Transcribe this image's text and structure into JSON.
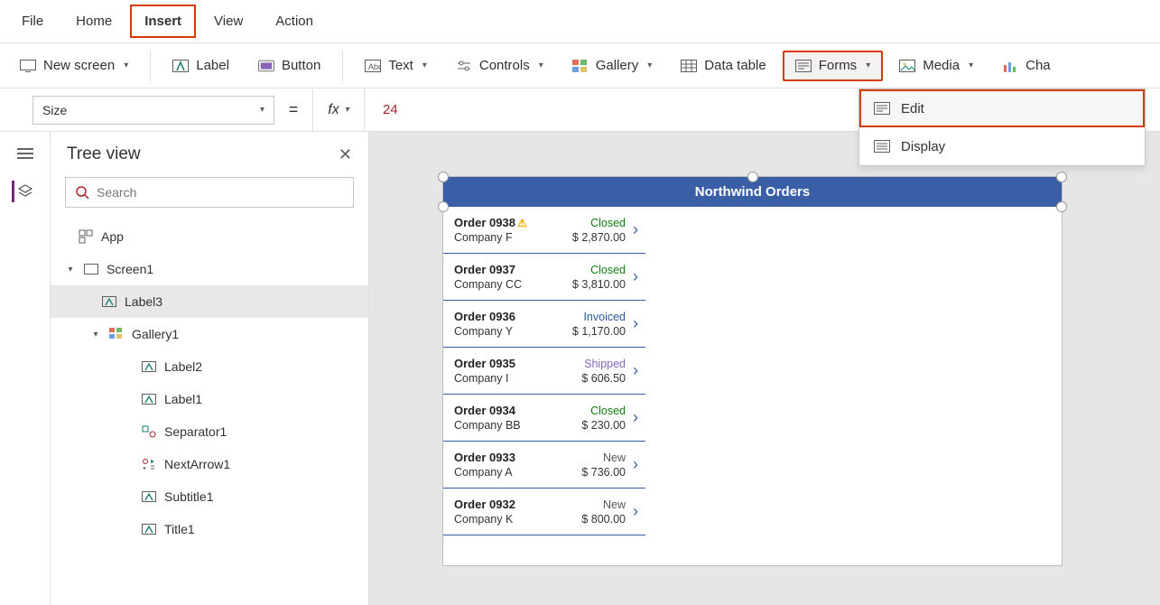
{
  "menu": {
    "file": "File",
    "home": "Home",
    "insert": "Insert",
    "view": "View",
    "action": "Action"
  },
  "ribbon": {
    "new_screen": "New screen",
    "label": "Label",
    "button": "Button",
    "text": "Text",
    "controls": "Controls",
    "gallery": "Gallery",
    "data_table": "Data table",
    "forms": "Forms",
    "media": "Media",
    "charts": "Cha"
  },
  "forms_menu": {
    "edit": "Edit",
    "display": "Display"
  },
  "formula": {
    "property": "Size",
    "fx": "fx",
    "value": "24"
  },
  "tree": {
    "title": "Tree view",
    "search_placeholder": "Search",
    "app": "App",
    "screen1": "Screen1",
    "label3": "Label3",
    "gallery1": "Gallery1",
    "label2": "Label2",
    "label1": "Label1",
    "separator1": "Separator1",
    "nextarrow1": "NextArrow1",
    "subtitle1": "Subtitle1",
    "title1": "Title1"
  },
  "canvas": {
    "banner": "Northwind Orders"
  },
  "orders": [
    {
      "id": "Order 0938",
      "warn": true,
      "company": "Company F",
      "status": "Closed",
      "status_cls": "st-closed",
      "amount": "$ 2,870.00"
    },
    {
      "id": "Order 0937",
      "warn": false,
      "company": "Company CC",
      "status": "Closed",
      "status_cls": "st-closed",
      "amount": "$ 3,810.00"
    },
    {
      "id": "Order 0936",
      "warn": false,
      "company": "Company Y",
      "status": "Invoiced",
      "status_cls": "st-invoiced",
      "amount": "$ 1,170.00"
    },
    {
      "id": "Order 0935",
      "warn": false,
      "company": "Company I",
      "status": "Shipped",
      "status_cls": "st-shipped",
      "amount": "$ 606.50"
    },
    {
      "id": "Order 0934",
      "warn": false,
      "company": "Company BB",
      "status": "Closed",
      "status_cls": "st-closed",
      "amount": "$ 230.00"
    },
    {
      "id": "Order 0933",
      "warn": false,
      "company": "Company A",
      "status": "New",
      "status_cls": "st-new",
      "amount": "$ 736.00"
    },
    {
      "id": "Order 0932",
      "warn": false,
      "company": "Company K",
      "status": "New",
      "status_cls": "st-new",
      "amount": "$ 800.00"
    }
  ]
}
